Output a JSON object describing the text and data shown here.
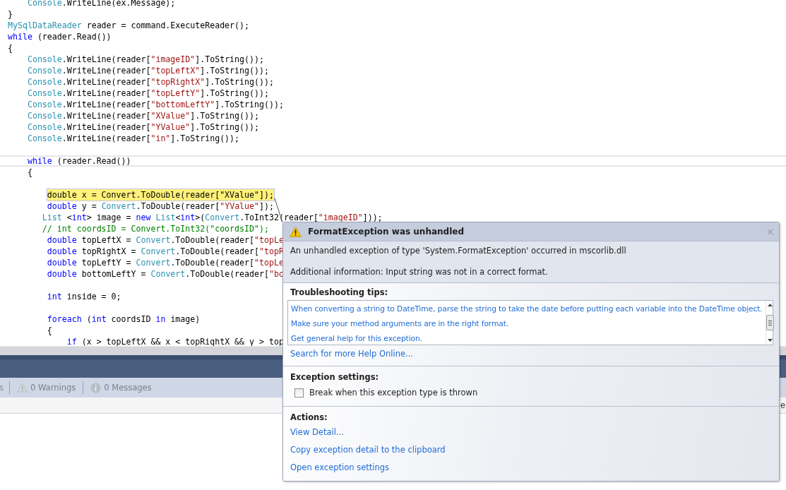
{
  "editor": {
    "lines": [
      {
        "kind": "code",
        "tokens": [
          {
            "text": "    Console",
            "kind": "type"
          },
          {
            "text": ".WriteLine(ex.Message);",
            "kind": "plain"
          }
        ]
      },
      {
        "kind": "code",
        "tokens": [
          {
            "text": "}",
            "kind": "plain"
          }
        ]
      },
      {
        "kind": "code",
        "tokens": [
          {
            "text": "MySqlDataReader",
            "kind": "type"
          },
          {
            "text": " reader = command.ExecuteReader();",
            "kind": "plain"
          }
        ]
      },
      {
        "kind": "code",
        "tokens": [
          {
            "text": "while",
            "kind": "keyword"
          },
          {
            "text": " (reader.Read())",
            "kind": "plain"
          }
        ]
      },
      {
        "kind": "code",
        "tokens": [
          {
            "text": "{",
            "kind": "plain"
          }
        ]
      },
      {
        "kind": "code",
        "tokens": [
          {
            "text": "    Console",
            "kind": "type"
          },
          {
            "text": ".WriteLine(reader[",
            "kind": "plain"
          },
          {
            "text": "\"imageID\"",
            "kind": "string"
          },
          {
            "text": "].ToString());",
            "kind": "plain"
          }
        ]
      },
      {
        "kind": "code",
        "tokens": [
          {
            "text": "    Console",
            "kind": "type"
          },
          {
            "text": ".WriteLine(reader[",
            "kind": "plain"
          },
          {
            "text": "\"topLeftX\"",
            "kind": "string"
          },
          {
            "text": "].ToString());",
            "kind": "plain"
          }
        ]
      },
      {
        "kind": "code",
        "tokens": [
          {
            "text": "    Console",
            "kind": "type"
          },
          {
            "text": ".WriteLine(reader[",
            "kind": "plain"
          },
          {
            "text": "\"topRightX\"",
            "kind": "string"
          },
          {
            "text": "].ToString());",
            "kind": "plain"
          }
        ]
      },
      {
        "kind": "code",
        "tokens": [
          {
            "text": "    Console",
            "kind": "type"
          },
          {
            "text": ".WriteLine(reader[",
            "kind": "plain"
          },
          {
            "text": "\"topLeftY\"",
            "kind": "string"
          },
          {
            "text": "].ToString());",
            "kind": "plain"
          }
        ]
      },
      {
        "kind": "code",
        "tokens": [
          {
            "text": "    Console",
            "kind": "type"
          },
          {
            "text": ".WriteLine(reader[",
            "kind": "plain"
          },
          {
            "text": "\"bottomLeftY\"",
            "kind": "string"
          },
          {
            "text": "].ToString());",
            "kind": "plain"
          }
        ]
      },
      {
        "kind": "code",
        "tokens": [
          {
            "text": "    Console",
            "kind": "type"
          },
          {
            "text": ".WriteLine(reader[",
            "kind": "plain"
          },
          {
            "text": "\"XValue\"",
            "kind": "string"
          },
          {
            "text": "].ToString());",
            "kind": "plain"
          }
        ]
      },
      {
        "kind": "code",
        "tokens": [
          {
            "text": "    Console",
            "kind": "type"
          },
          {
            "text": ".WriteLine(reader[",
            "kind": "plain"
          },
          {
            "text": "\"YValue\"",
            "kind": "string"
          },
          {
            "text": "].ToString());",
            "kind": "plain"
          }
        ]
      },
      {
        "kind": "code",
        "tokens": [
          {
            "text": "    Console",
            "kind": "type"
          },
          {
            "text": ".WriteLine(reader[",
            "kind": "plain"
          },
          {
            "text": "\"in\"",
            "kind": "string"
          },
          {
            "text": "].ToString());",
            "kind": "plain"
          }
        ]
      },
      {
        "kind": "blank"
      },
      {
        "kind": "caret",
        "tokens": [
          {
            "text": "    while",
            "kind": "keyword"
          },
          {
            "text": " (reader.Read())",
            "kind": "plain"
          }
        ]
      },
      {
        "kind": "code",
        "tokens": [
          {
            "text": "    {",
            "kind": "plain"
          }
        ]
      },
      {
        "kind": "blank"
      },
      {
        "kind": "current",
        "tokens": [
          {
            "text": "double x = Convert.ToDouble(reader[\"XValue\"]);",
            "kind": "plain"
          }
        ]
      },
      {
        "kind": "code",
        "tokens": [
          {
            "text": "        double",
            "kind": "keyword"
          },
          {
            "text": " y = ",
            "kind": "plain"
          },
          {
            "text": "Convert",
            "kind": "type"
          },
          {
            "text": ".ToDouble(reader[",
            "kind": "plain"
          },
          {
            "text": "\"YValue\"",
            "kind": "string"
          },
          {
            "text": "]);",
            "kind": "plain"
          }
        ]
      },
      {
        "kind": "code",
        "tokens": [
          {
            "text": "       List",
            "kind": "type"
          },
          {
            "text": " <",
            "kind": "plain"
          },
          {
            "text": "int",
            "kind": "keyword"
          },
          {
            "text": "> image = ",
            "kind": "plain"
          },
          {
            "text": "new",
            "kind": "keyword"
          },
          {
            "text": " List",
            "kind": "type"
          },
          {
            "text": "<",
            "kind": "plain"
          },
          {
            "text": "int",
            "kind": "keyword"
          },
          {
            "text": ">(",
            "kind": "plain"
          },
          {
            "text": "Convert",
            "kind": "type"
          },
          {
            "text": ".ToInt32(reader[",
            "kind": "plain"
          },
          {
            "text": "\"imageID\"",
            "kind": "string"
          },
          {
            "text": "]));",
            "kind": "plain"
          }
        ]
      },
      {
        "kind": "code",
        "tokens": [
          {
            "text": "       // int coordsID = Convert.ToInt32(\"coordsID\");",
            "kind": "comment"
          }
        ]
      },
      {
        "kind": "code",
        "tokens": [
          {
            "text": "        double",
            "kind": "keyword"
          },
          {
            "text": " topLeftX = ",
            "kind": "plain"
          },
          {
            "text": "Convert",
            "kind": "type"
          },
          {
            "text": ".ToDouble(reader[",
            "kind": "plain"
          },
          {
            "text": "\"topLe",
            "kind": "string"
          }
        ]
      },
      {
        "kind": "code",
        "tokens": [
          {
            "text": "        double",
            "kind": "keyword"
          },
          {
            "text": " topRightX = ",
            "kind": "plain"
          },
          {
            "text": "Convert",
            "kind": "type"
          },
          {
            "text": ".ToDouble(reader[",
            "kind": "plain"
          },
          {
            "text": "\"topR",
            "kind": "string"
          }
        ]
      },
      {
        "kind": "code",
        "tokens": [
          {
            "text": "        double",
            "kind": "keyword"
          },
          {
            "text": " topLeftY = ",
            "kind": "plain"
          },
          {
            "text": "Convert",
            "kind": "type"
          },
          {
            "text": ".ToDouble(reader[",
            "kind": "plain"
          },
          {
            "text": "\"topLe",
            "kind": "string"
          }
        ]
      },
      {
        "kind": "code",
        "tokens": [
          {
            "text": "        double",
            "kind": "keyword"
          },
          {
            "text": " bottomLeftY = ",
            "kind": "plain"
          },
          {
            "text": "Convert",
            "kind": "type"
          },
          {
            "text": ".ToDouble(reader[",
            "kind": "plain"
          },
          {
            "text": "\"bo",
            "kind": "string"
          }
        ]
      },
      {
        "kind": "blank"
      },
      {
        "kind": "code",
        "tokens": [
          {
            "text": "        int",
            "kind": "keyword"
          },
          {
            "text": " inside = 0;",
            "kind": "plain"
          }
        ]
      },
      {
        "kind": "blank"
      },
      {
        "kind": "code",
        "tokens": [
          {
            "text": "        foreach",
            "kind": "keyword"
          },
          {
            "text": " (",
            "kind": "plain"
          },
          {
            "text": "int",
            "kind": "keyword"
          },
          {
            "text": " coordsID ",
            "kind": "plain"
          },
          {
            "text": "in",
            "kind": "keyword"
          },
          {
            "text": " image)",
            "kind": "plain"
          }
        ]
      },
      {
        "kind": "code",
        "tokens": [
          {
            "text": "        {",
            "kind": "plain"
          }
        ]
      },
      {
        "kind": "code",
        "tokens": [
          {
            "text": "            if",
            "kind": "keyword"
          },
          {
            "text": " (x > topLeftX && x < topRightX && y > top",
            "kind": "plain"
          }
        ]
      }
    ]
  },
  "error_list": {
    "items": [
      {
        "kind": "fragment",
        "label": "s"
      },
      {
        "kind": "warning",
        "label": "0 Warnings"
      },
      {
        "kind": "info",
        "label": "0 Messages"
      }
    ],
    "fragment": "e"
  },
  "exception": {
    "title": "FormatException was unhandled",
    "message": "An unhandled exception of type 'System.FormatException' occurred in mscorlib.dll",
    "additional": "Additional information: Input string was not in a correct format.",
    "tips_heading": "Troubleshooting tips:",
    "tips": [
      "When converting a string to DateTime, parse the string to take the date before putting each variable into the DateTime object.",
      "Make sure your method arguments are in the right format.",
      "Get general help for this exception."
    ],
    "search_link": "Search for more Help Online...",
    "settings_heading": "Exception settings:",
    "break_option": {
      "label": "Break when this exception type is thrown",
      "checked": false
    },
    "actions_heading": "Actions:",
    "actions": [
      "View Detail...",
      "Copy exception detail to the clipboard",
      "Open exception settings"
    ]
  }
}
